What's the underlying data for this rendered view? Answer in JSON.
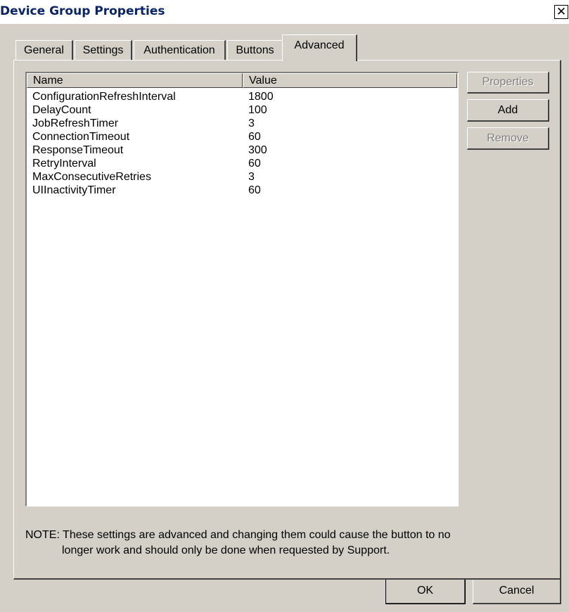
{
  "window": {
    "title": "Device Group Properties",
    "close_glyph": "✕"
  },
  "tabs": [
    {
      "label": "General",
      "active": false
    },
    {
      "label": "Settings",
      "active": false
    },
    {
      "label": "Authentication",
      "active": false
    },
    {
      "label": "Buttons",
      "active": false
    },
    {
      "label": "Advanced",
      "active": true
    }
  ],
  "list": {
    "columns": [
      "Name",
      "Value"
    ],
    "rows": [
      {
        "name": "ConfigurationRefreshInterval",
        "value": "1800"
      },
      {
        "name": "DelayCount",
        "value": "100"
      },
      {
        "name": "JobRefreshTimer",
        "value": "3"
      },
      {
        "name": "ConnectionTimeout",
        "value": "60"
      },
      {
        "name": "ResponseTimeout",
        "value": "300"
      },
      {
        "name": "RetryInterval",
        "value": "60"
      },
      {
        "name": "MaxConsecutiveRetries",
        "value": "3"
      },
      {
        "name": "UIInactivityTimer",
        "value": "60"
      }
    ]
  },
  "side_buttons": {
    "properties": "Properties",
    "add": "Add",
    "remove": "Remove"
  },
  "note": {
    "line1": "NOTE: These settings are advanced and changing them could cause the button to no",
    "line2": "longer work and should only be done when requested by Support."
  },
  "footer": {
    "ok": "OK",
    "cancel": "Cancel"
  }
}
